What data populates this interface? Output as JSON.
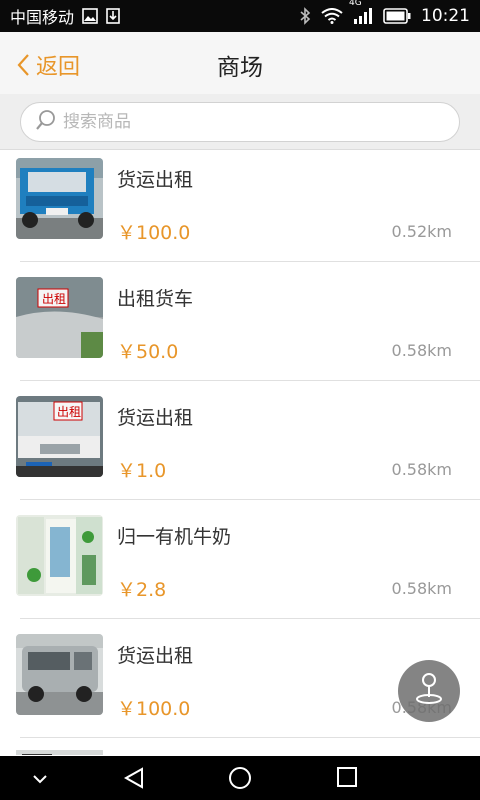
{
  "status_bar": {
    "carrier": "中国移动",
    "network": "4G",
    "time": "10:21",
    "icons": [
      "image-icon",
      "download-icon",
      "bluetooth-icon",
      "wifi-icon",
      "signal-icon",
      "battery-icon"
    ]
  },
  "header": {
    "back_label": "返回",
    "title": "商场"
  },
  "search": {
    "placeholder": "搜索商品"
  },
  "items": [
    {
      "title": "货运出租",
      "price": "￥100.0",
      "distance": "0.52km",
      "thumb": "blue-truck"
    },
    {
      "title": "出租货车",
      "price": "￥50.0",
      "distance": "0.58km",
      "thumb": "silver-car-sign"
    },
    {
      "title": "货运出租",
      "price": "￥1.0",
      "distance": "0.58km",
      "thumb": "white-truck-sign"
    },
    {
      "title": "归一有机牛奶",
      "price": "￥2.8",
      "distance": "0.58km",
      "thumb": "milk-poster"
    },
    {
      "title": "货运出租",
      "price": "￥100.0",
      "distance": "0.58km",
      "thumb": "grey-van"
    }
  ],
  "colors": {
    "accent": "#e8962a",
    "status_bar": "#0a0a0a",
    "header_bg": "#f6f6f6",
    "search_bg": "#eeeeee",
    "title_text": "#333333",
    "distance_text": "#999999"
  },
  "fab_icon": "map-pin-icon",
  "nav_icons": [
    "chevron-down-icon",
    "back-triangle-icon",
    "home-circle-icon",
    "recents-square-icon"
  ]
}
